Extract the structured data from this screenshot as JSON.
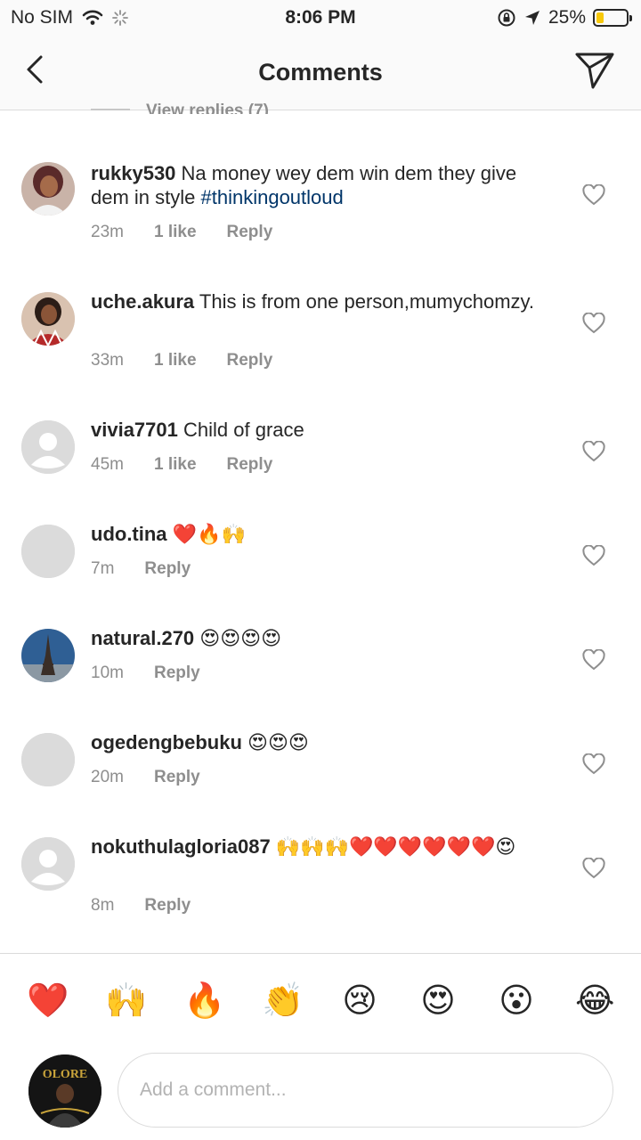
{
  "status_bar": {
    "carrier": "No SIM",
    "time": "8:06 PM",
    "battery": "25%",
    "battery_level": 0.25,
    "battery_color": "#f7c80a"
  },
  "header": {
    "title": "Comments",
    "back_icon": "chevron-left-icon",
    "send_icon": "paper-plane-icon"
  },
  "view_replies": "View replies (7)",
  "comments": [
    {
      "username": "rukky530",
      "text": "Na money wey dem win dem they give dem in style ",
      "hashtag": "#thinkingoutloud",
      "time": "23m",
      "likes": "1 like",
      "reply": "Reply"
    },
    {
      "username": "uche.akura",
      "text": "This is from one person,mumychomzy.",
      "time": "33m",
      "likes": "1 like",
      "reply": "Reply"
    },
    {
      "username": "vivia7701",
      "text": "Child of grace",
      "time": "45m",
      "likes": "1 like",
      "reply": "Reply"
    },
    {
      "username": "udo.tina",
      "text": "❤️🔥🙌",
      "time": "7m",
      "reply": "Reply"
    },
    {
      "username": "natural.270",
      "text": "😍😍😍😍",
      "time": "10m",
      "reply": "Reply"
    },
    {
      "username": "ogedengbebuku",
      "text": "😍😍😍",
      "time": "20m",
      "reply": "Reply"
    },
    {
      "username": "nokuthulagloria087",
      "text": "🙌🙌🙌❤️❤️❤️❤️❤️❤️😍",
      "time": "8m",
      "reply": "Reply"
    }
  ],
  "reactions": [
    "❤️",
    "🙌",
    "🔥",
    "👏",
    "😢",
    "😍",
    "😮",
    "😂"
  ],
  "composer": {
    "placeholder": "Add a comment...",
    "avatar_text": "OLORE"
  }
}
